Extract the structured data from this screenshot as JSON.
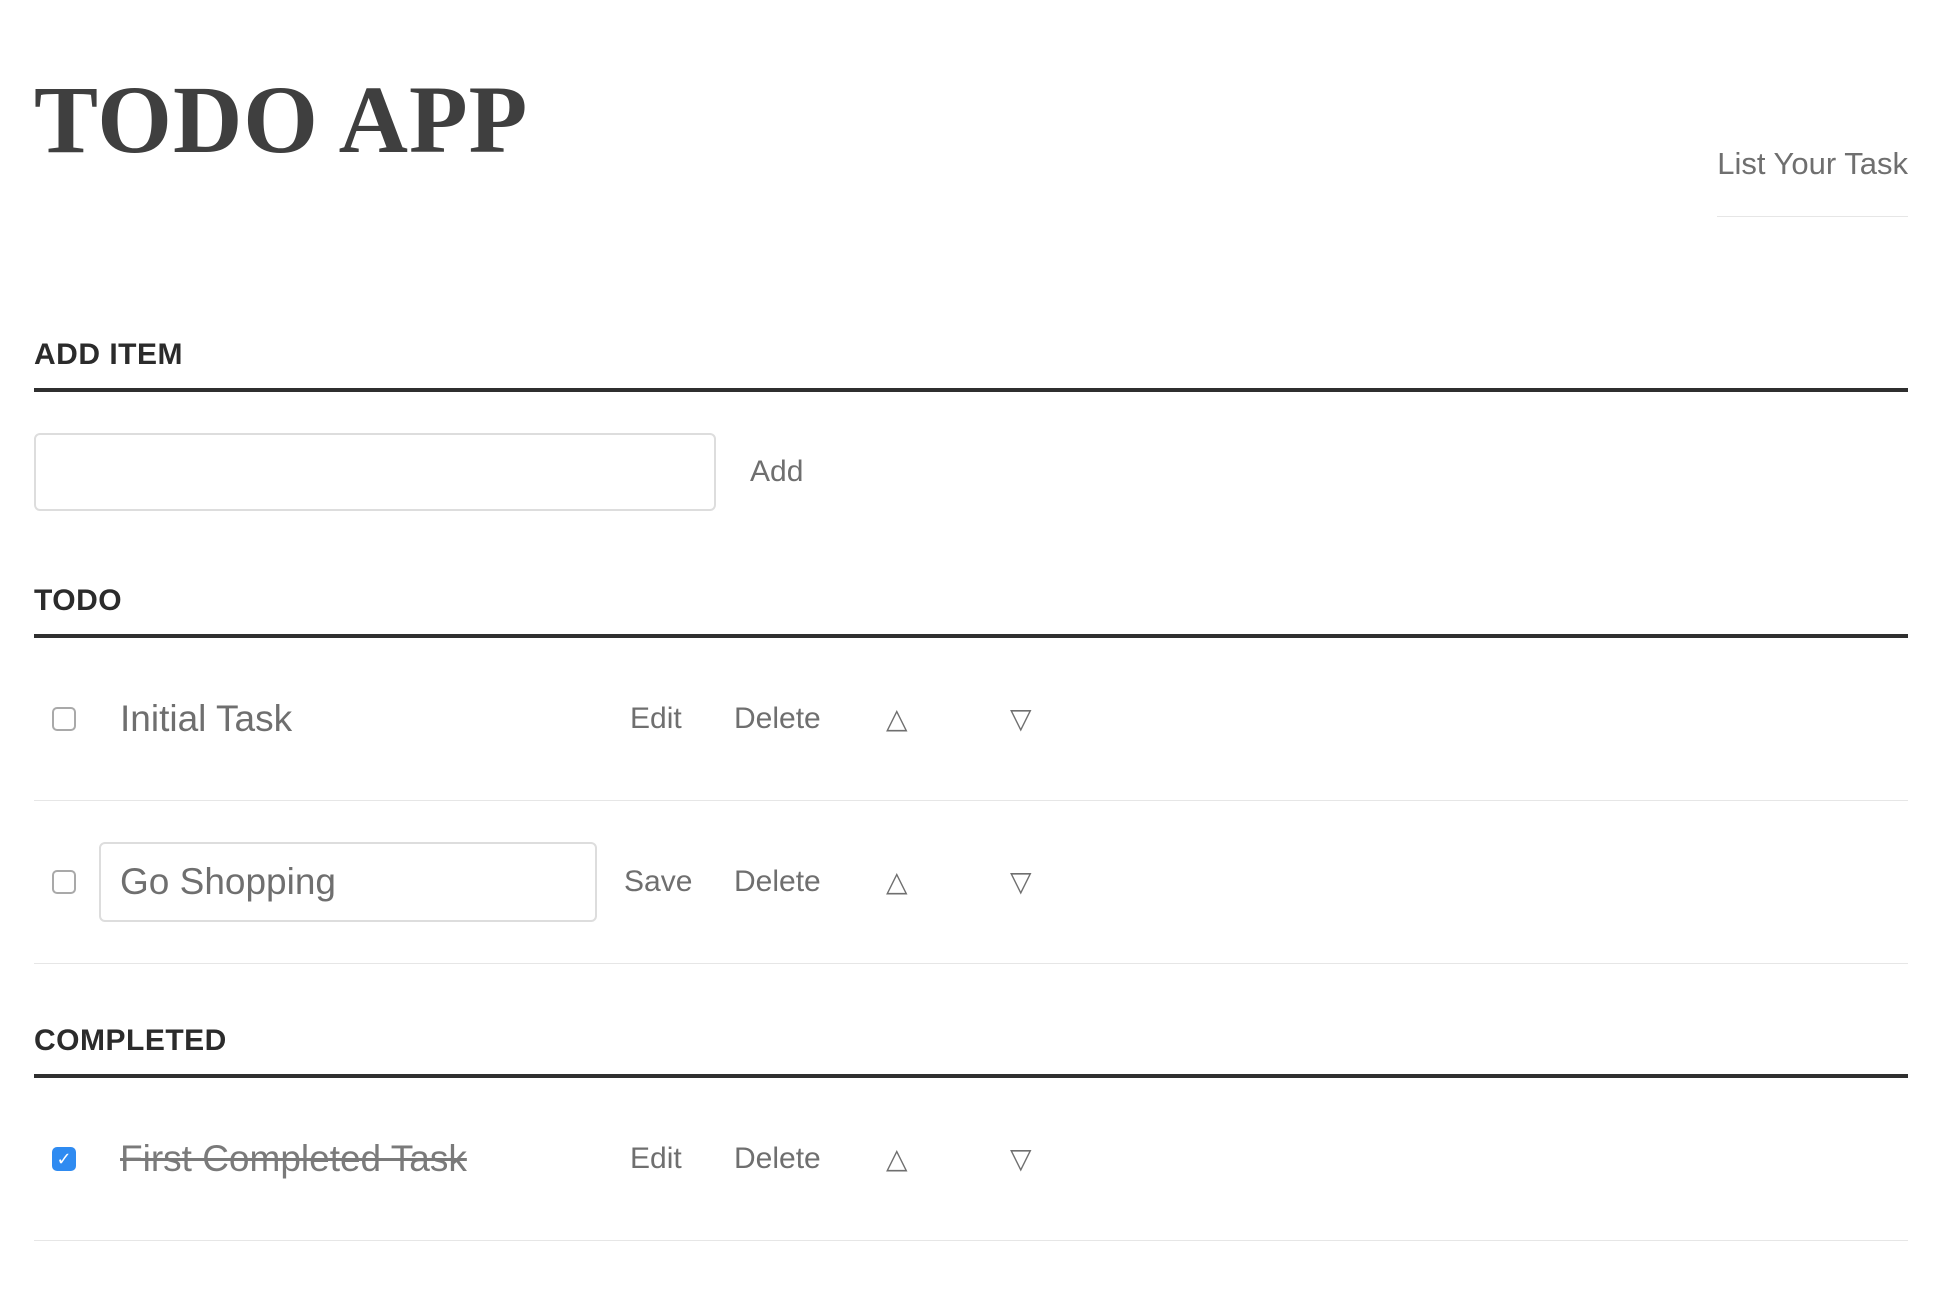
{
  "header": {
    "title": "TODO APP",
    "nav_link": "List Your Task"
  },
  "add_item": {
    "heading": "ADD ITEM",
    "input_value": "",
    "add_label": "Add"
  },
  "todo": {
    "heading": "TODO",
    "items": [
      {
        "text": "Initial Task",
        "checked": false,
        "editing": false,
        "edit_label": "Edit",
        "delete_label": "Delete",
        "up_icon": "△",
        "down_icon": "▽"
      },
      {
        "text": "Go Shopping",
        "checked": false,
        "editing": true,
        "save_label": "Save",
        "delete_label": "Delete",
        "up_icon": "△",
        "down_icon": "▽"
      }
    ]
  },
  "completed": {
    "heading": "COMPLETED",
    "items": [
      {
        "text": "First Completed Task",
        "checked": true,
        "editing": false,
        "edit_label": "Edit",
        "delete_label": "Delete",
        "up_icon": "△",
        "down_icon": "▽",
        "check_icon": "✓"
      }
    ]
  },
  "colors": {
    "checkbox_checked": "#2f8bf1",
    "heading_rule": "#2f2f2f",
    "text_muted": "#6f6f6f"
  }
}
